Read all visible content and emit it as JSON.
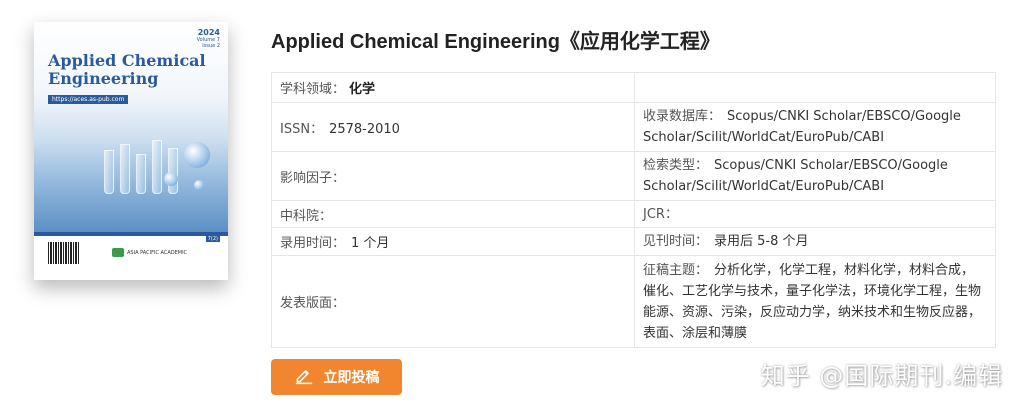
{
  "cover": {
    "title_line1": "Applied Chemical",
    "title_line2": "Engineering",
    "url": "https://aces.as-pub.com",
    "year": "2024",
    "volume": "Volume 7",
    "issue": "Issue 2",
    "publisher": "ASIA PACIFIC ACADEMIC",
    "badge": "7(2)"
  },
  "journal_title": "Applied Chemical Engineering《应用化学工程》",
  "rows": [
    {
      "left_label": "学科领域：",
      "left_value": "化学",
      "right_label": "",
      "right_value": ""
    },
    {
      "left_label": "ISSN：",
      "left_value": "2578-2010",
      "right_label": "收录数据库：",
      "right_value": "Scopus/CNKI Scholar/EBSCO/Google Scholar/Scilit/WorldCat/EuroPub/CABI"
    },
    {
      "left_label": "影响因子：",
      "left_value": "",
      "right_label": "检索类型：",
      "right_value": "Scopus/CNKI Scholar/EBSCO/Google Scholar/Scilit/WorldCat/EuroPub/CABI"
    },
    {
      "left_label": "中科院：",
      "left_value": "",
      "right_label": "JCR：",
      "right_value": ""
    },
    {
      "left_label": "录用时间：",
      "left_value": "1 个月",
      "right_label": "见刊时间：",
      "right_value": "录用后 5-8 个月"
    },
    {
      "left_label": "发表版面：",
      "left_value": "",
      "right_label": "征稿主题：",
      "right_value": "分析化学，化学工程，材料化学，材料合成，催化、工艺化学与技术，量子化学法，环境化学工程，生物能源、资源、污染，反应动力学，纳米技术和生物反应器，表面、涂层和薄膜"
    }
  ],
  "submit_label": "立即投稿",
  "submit_icon": "pencil-edit-icon",
  "watermark": "知乎 @国际期刊.编辑",
  "colors": {
    "accent": "#f2862e",
    "cover_blue": "#2b5a9a"
  }
}
